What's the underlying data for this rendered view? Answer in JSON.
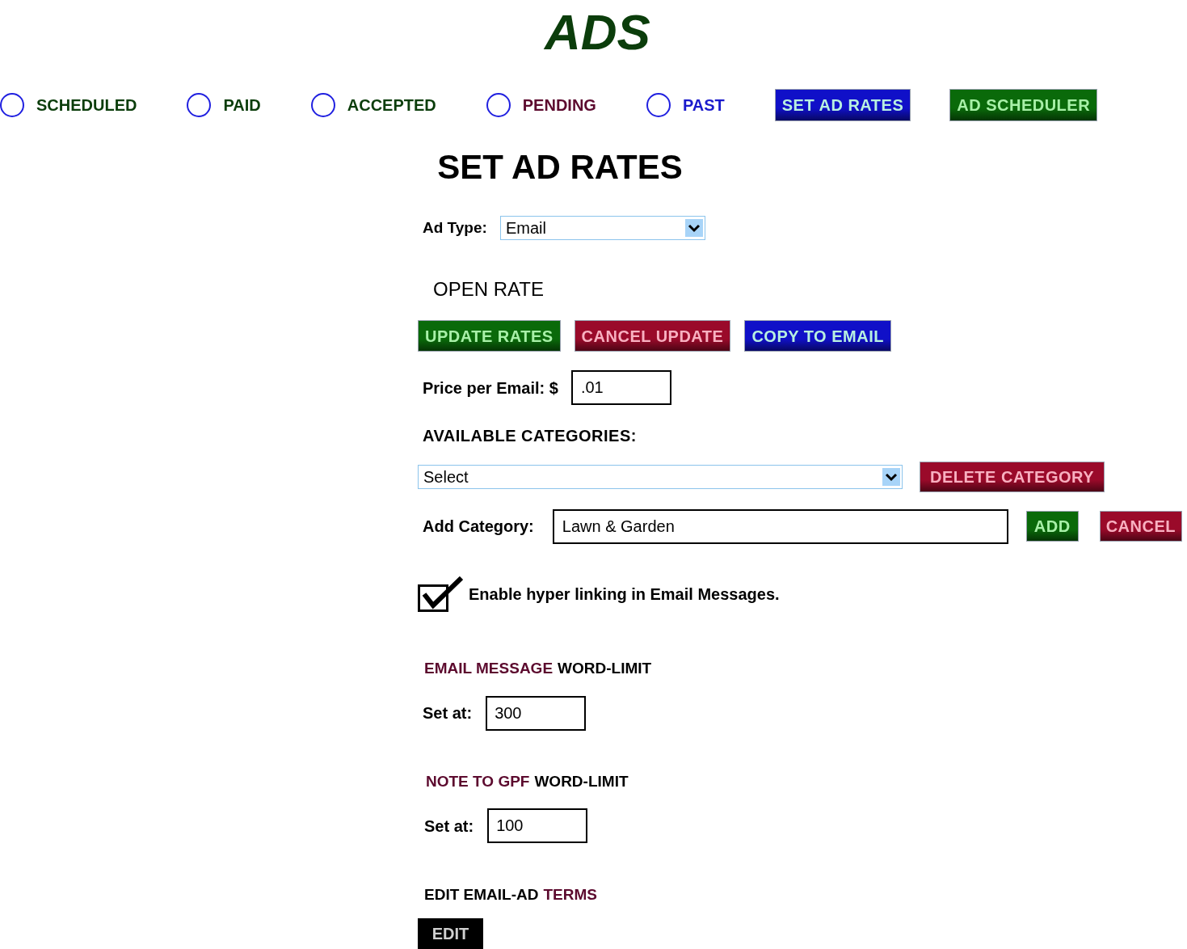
{
  "logo": "ADS",
  "nav": [
    {
      "kind": "radio",
      "label": "SCHEDULED",
      "selected": false,
      "color": "#0b3d0b"
    },
    {
      "kind": "radio",
      "label": "PAID",
      "selected": false,
      "color": "#0b3d0b"
    },
    {
      "kind": "radio",
      "label": "ACCEPTED",
      "selected": false,
      "color": "#0b3d0b"
    },
    {
      "kind": "radio",
      "label": "PENDING",
      "selected": false,
      "color": "#5c0a2e"
    },
    {
      "kind": "radio",
      "label": "PAST",
      "selected": false,
      "color": "#1a1acc"
    },
    {
      "kind": "button",
      "label": "SET AD RATES",
      "color": "#1010c8"
    },
    {
      "kind": "button",
      "label": "AD SCHEDULER",
      "color": "#0a6a0a"
    }
  ],
  "page_title": "SET AD RATES",
  "ad_type": {
    "label": "Ad Type:",
    "value": "Email"
  },
  "open_rate": "OPEN RATE",
  "rate_buttons": [
    {
      "label": "UPDATE RATES",
      "color": "#0a6a0a"
    },
    {
      "label": "CANCEL UPDATE",
      "color": "#9a0a2a"
    },
    {
      "label": "COPY TO EMAIL",
      "color": "#1010c8"
    }
  ],
  "price": {
    "label": "Price per Email: $",
    "value": ".01"
  },
  "categories": {
    "label": "AVAILABLE CATEGORIES:",
    "select_value": "Select",
    "delete_button": "DELETE CATEGORY",
    "add_label": "Add Category:",
    "add_value": "Lawn & Garden",
    "add_button": "ADD",
    "cancel_button": "CANCEL"
  },
  "hyperlinking": {
    "checked": true,
    "label": "Enable hyper linking in Email Messages."
  },
  "limits": [
    {
      "heading": [
        {
          "text": "EMAIL MESSAGE",
          "color": "#5c0a2e"
        },
        {
          "text": "WORD-LIMIT",
          "color": "#000000"
        }
      ],
      "label": "Set at:",
      "value": "300"
    },
    {
      "heading": [
        {
          "text": "NOTE TO GPF",
          "color": "#5c0a2e"
        },
        {
          "text": "WORD-LIMIT",
          "color": "#000000"
        }
      ],
      "label": "Set at:",
      "value": "100"
    }
  ],
  "terms": {
    "heading": [
      {
        "text": "EDIT EMAIL-AD",
        "color": "#000000"
      },
      {
        "text": "TERMS",
        "color": "#5c0a2e"
      }
    ],
    "button": "EDIT"
  }
}
